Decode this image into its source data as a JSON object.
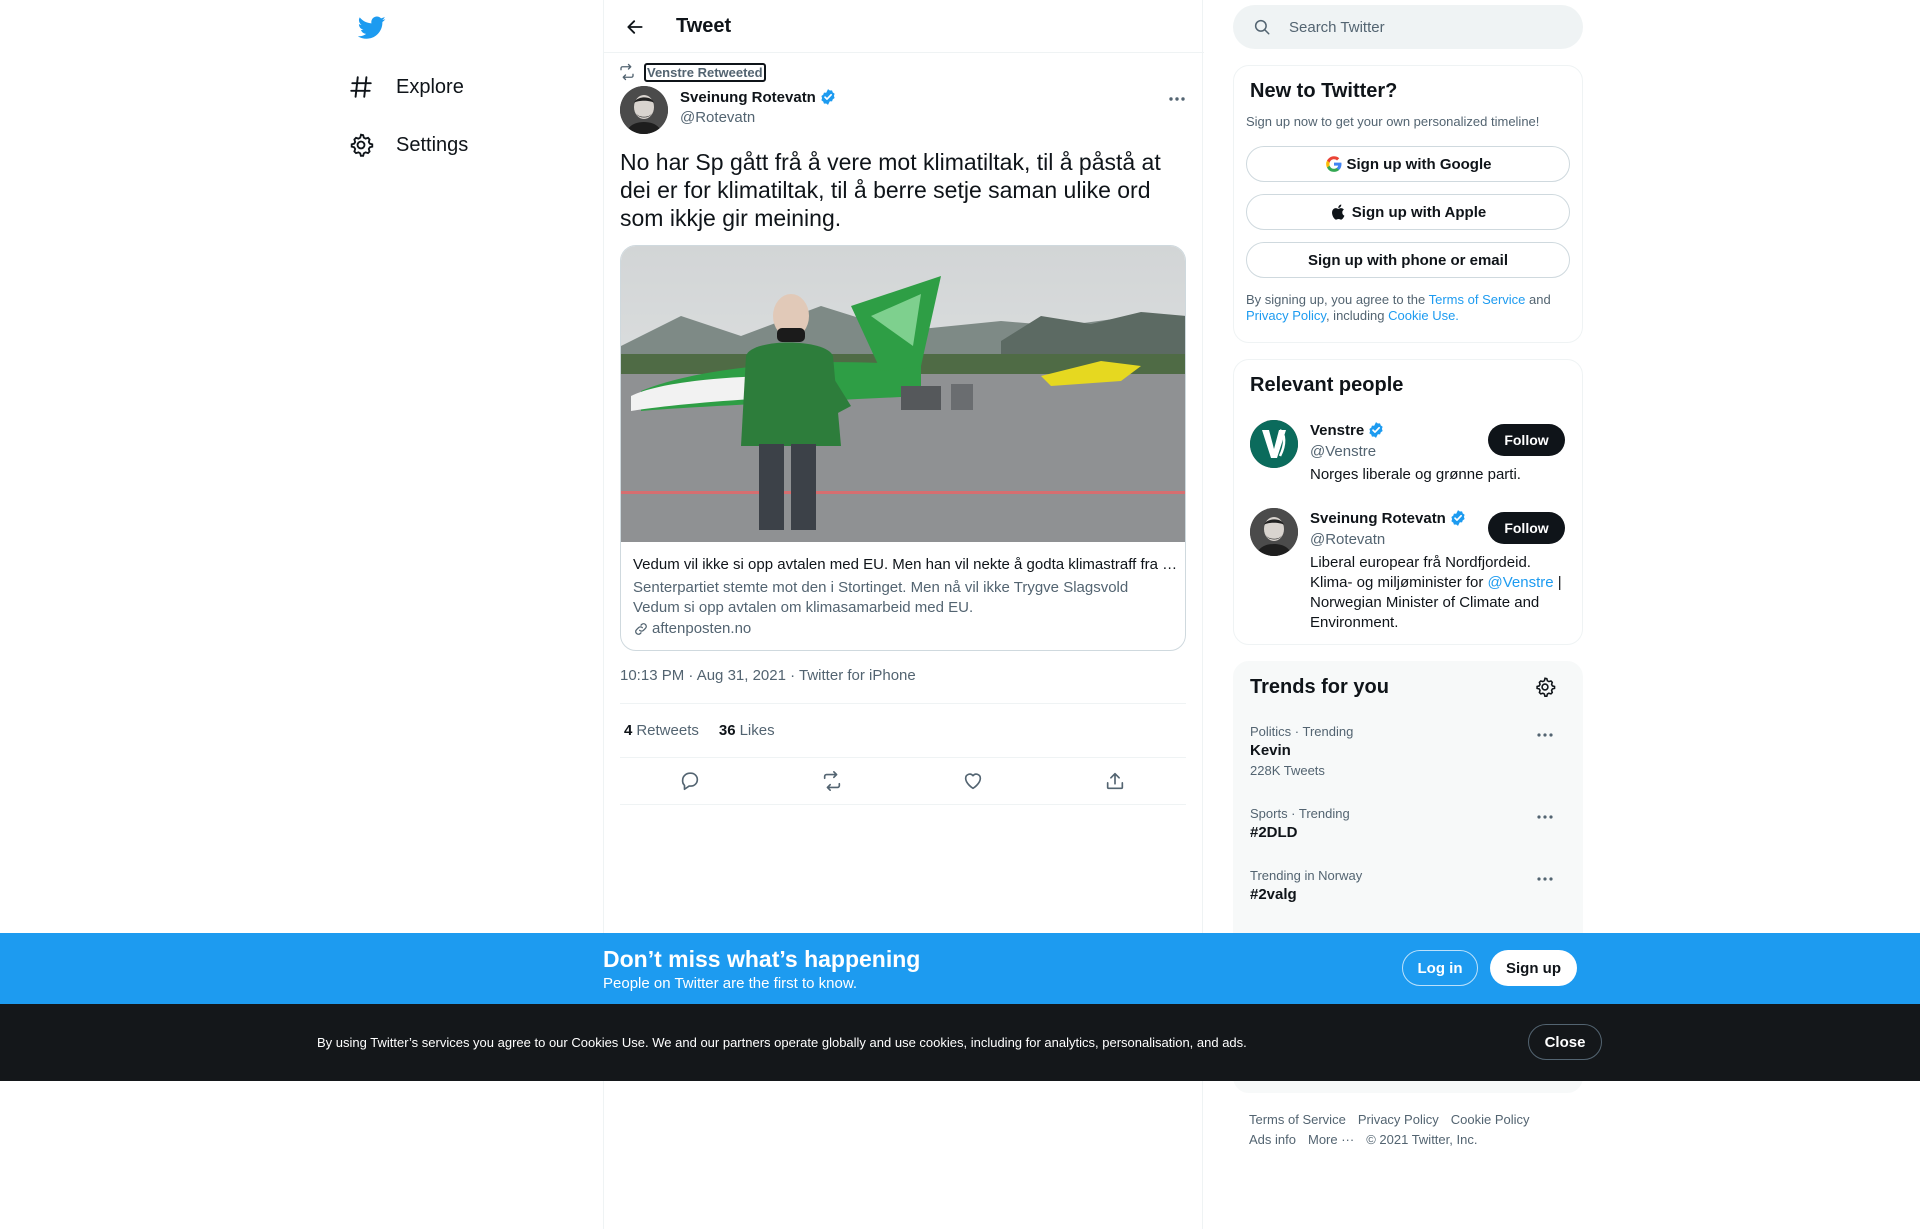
{
  "colors": {
    "brand": "#1d9bf0",
    "text": "#0f1419",
    "secondary": "#536471",
    "border": "#eff3f4",
    "cookie_bg": "#14171a"
  },
  "nav": {
    "logo_icon": "twitter-bird-icon",
    "items": [
      {
        "label": "Explore",
        "icon": "hashtag-icon"
      },
      {
        "label": "Settings",
        "icon": "gear-icon"
      }
    ]
  },
  "header": {
    "title": "Tweet",
    "back_icon": "arrow-left-icon"
  },
  "tweet": {
    "retweeted_by": "Venstre Retweeted",
    "author_name": "Sveinung Rotevatn",
    "author_handle": "@Rotevatn",
    "text": "No har Sp gått frå å vere mot klimatiltak, til å påstå at dei er for klimatiltak, til å berre setje saman ulike ord som ikkje gir meining.",
    "card": {
      "title": "Vedum vil ikke si opp avtalen med EU. Men han vil nekte å godta klimastraff fra EU.",
      "description": "Senterpartiet stemte mot den i Stortinget. Men nå vil ikke Trygve Slagsvold Vedum si opp avtalen om klimasamarbeid med EU.",
      "domain": "aftenposten.no"
    },
    "meta": "10:13 PM · Aug 31, 2021 · Twitter for iPhone",
    "retweets_count": "4",
    "retweets_label": "Retweets",
    "likes_count": "36",
    "likes_label": "Likes"
  },
  "search": {
    "placeholder": "Search Twitter"
  },
  "signup": {
    "title": "New to Twitter?",
    "subtitle": "Sign up now to get your own personalized timeline!",
    "google": "Sign up with Google",
    "apple": "Sign up with Apple",
    "phone": "Sign up with phone or email",
    "legal_1": "By signing up, you agree to the ",
    "terms": "Terms of Service",
    "legal_2": " and ",
    "privacy": "Privacy Policy",
    "legal_3": ", including ",
    "cookie": "Cookie Use."
  },
  "relevant": {
    "title": "Relevant people",
    "follow_label": "Follow",
    "people": [
      {
        "name": "Venstre",
        "handle": "@Venstre",
        "bio": "Norges liberale og grønne parti."
      },
      {
        "name": "Sveinung Rotevatn",
        "handle": "@Rotevatn",
        "bio_1": "Liberal europear frå Nordfjordeid. Klima- og miljøminister for ",
        "bio_link": "@Venstre",
        "bio_2": " | Norwegian Minister of Climate and Environment."
      }
    ]
  },
  "trends": {
    "title": "Trends for you",
    "items": [
      {
        "category": "Politics · Trending",
        "name": "Kevin",
        "count": "228K Tweets"
      },
      {
        "category": "Sports · Trending",
        "name": "#2DLD",
        "count": ""
      },
      {
        "category": "Trending in Norway",
        "name": "#2valg",
        "count": ""
      }
    ]
  },
  "footer": {
    "links": [
      "Terms of Service",
      "Privacy Policy",
      "Cookie Policy",
      "Ads info",
      "More ···",
      "© 2021 Twitter, Inc."
    ]
  },
  "banner": {
    "title": "Don’t miss what’s happening",
    "subtitle": "People on Twitter are the first to know.",
    "login": "Log in",
    "signup": "Sign up"
  },
  "cookies": {
    "text": "By using Twitter’s services you agree to our Cookies Use. We and our partners operate globally and use cookies, including for analytics, personalisation, and ads.",
    "close": "Close"
  }
}
